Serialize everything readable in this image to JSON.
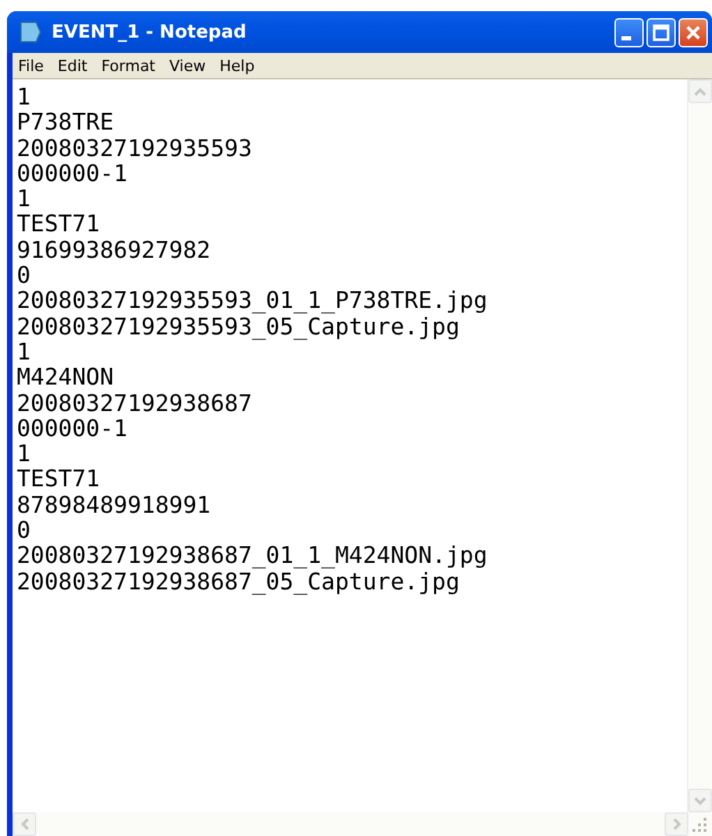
{
  "window": {
    "title": "EVENT_1 - Notepad"
  },
  "menu": [
    "File",
    "Edit",
    "Format",
    "View",
    "Help"
  ],
  "lines": [
    "1",
    "P738TRE",
    "20080327192935593",
    "000000-1",
    "1",
    "TEST71",
    "91699386927982",
    "0",
    "20080327192935593_01_1_P738TRE.jpg",
    "20080327192935593_05_Capture.jpg",
    "1",
    "M424NON",
    "20080327192938687",
    "000000-1",
    "1",
    "TEST71",
    "87898489918991",
    "0",
    "20080327192938687_01_1_M424NON.jpg",
    "20080327192938687_05_Capture.jpg"
  ]
}
